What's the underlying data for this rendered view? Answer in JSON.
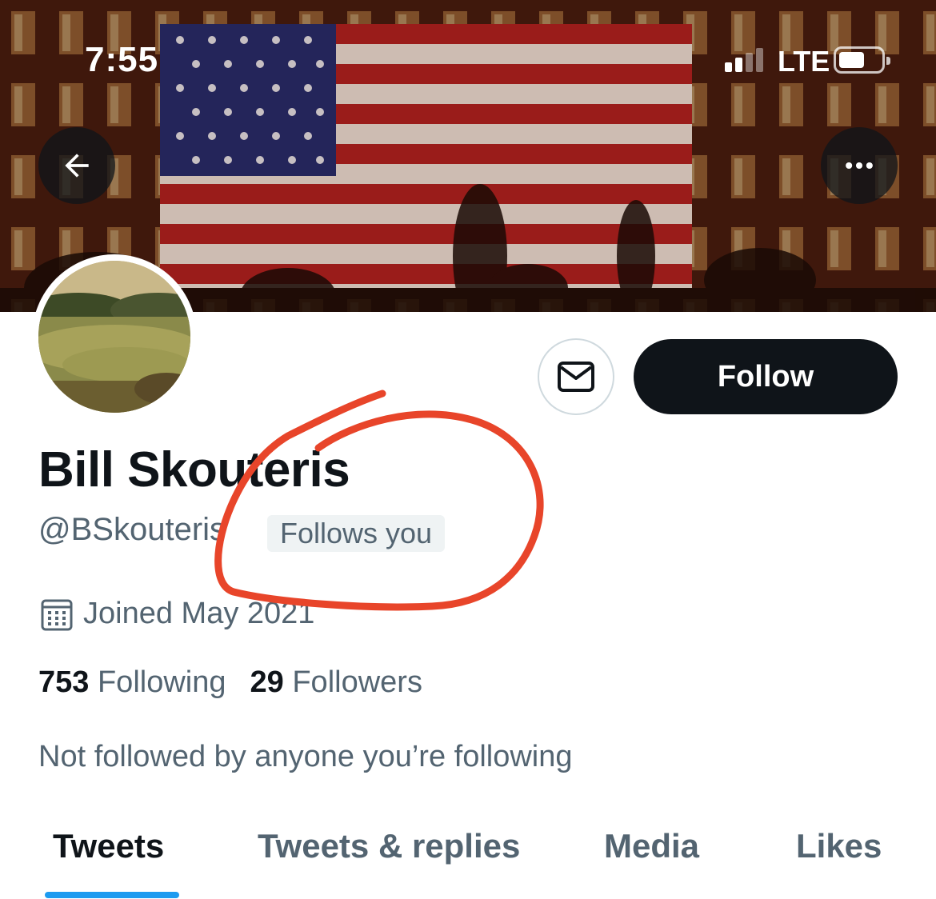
{
  "status_bar": {
    "time": "7:55",
    "network": "LTE",
    "signal_bars_active": 2,
    "signal_bars_total": 4,
    "battery_level": 0.6
  },
  "banner": {
    "icon": "american-flag-banner"
  },
  "header": {
    "back_icon": "arrow-left-icon",
    "more_icon": "ellipsis-icon"
  },
  "profile": {
    "name": "Bill Skouteris",
    "handle": "@BSkouteris",
    "follows_you_label": "Follows you",
    "joined": "Joined May 2021",
    "following_count": "753",
    "following_label": "Following",
    "followers_count": "29",
    "followers_label": "Followers",
    "not_followed_text": "Not followed by anyone you’re following"
  },
  "actions": {
    "message_icon": "envelope-icon",
    "follow_label": "Follow"
  },
  "tabs": [
    {
      "label": "Tweets",
      "active": true
    },
    {
      "label": "Tweets & replies",
      "active": false
    },
    {
      "label": "Media",
      "active": false
    },
    {
      "label": "Likes",
      "active": false
    }
  ],
  "colors": {
    "accent": "#1d9bf0",
    "text_primary": "#0f1419",
    "text_secondary": "#536471",
    "annotation": "#e8452a"
  }
}
